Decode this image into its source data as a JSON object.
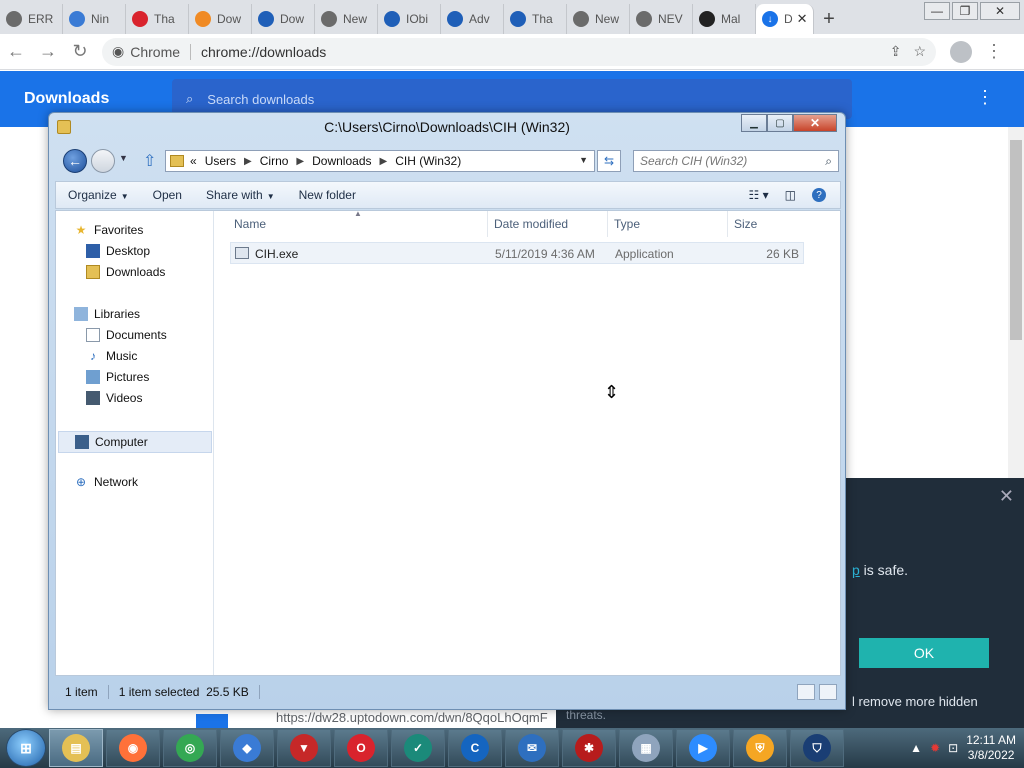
{
  "browser": {
    "tabs": [
      {
        "label": "ERR",
        "icon": "globe-icon",
        "color": "#6b6b6b"
      },
      {
        "label": "Nin",
        "icon": "shield-icon",
        "color": "#3a7bd5"
      },
      {
        "label": "Tha",
        "icon": "opera-icon",
        "color": "#d9232d"
      },
      {
        "label": "Dow",
        "icon": "avast-icon",
        "color": "#f08a24"
      },
      {
        "label": "Dow",
        "icon": "diamond-icon",
        "color": "#1f5fb8"
      },
      {
        "label": "New",
        "icon": "globe-icon",
        "color": "#6b6b6b"
      },
      {
        "label": "IObi",
        "icon": "iobit-icon",
        "color": "#1f5fb8"
      },
      {
        "label": "Adv",
        "icon": "iobit-icon",
        "color": "#1f5fb8"
      },
      {
        "label": "Tha",
        "icon": "iobit-icon",
        "color": "#1f5fb8"
      },
      {
        "label": "New",
        "icon": "globe-icon",
        "color": "#6b6b6b"
      },
      {
        "label": "NEV",
        "icon": "globe-icon",
        "color": "#6b6b6b"
      },
      {
        "label": "Mal",
        "icon": "github-icon",
        "color": "#222222"
      }
    ],
    "active_tab": {
      "label": "D",
      "icon": "download-icon"
    },
    "new_tab": "+",
    "window_controls": {
      "minimize": "—",
      "maximize": "❐",
      "close": "✕"
    },
    "site_chip": "Chrome",
    "url": "chrome://downloads"
  },
  "downloads": {
    "title": "Downloads",
    "search_placeholder": "Search downloads",
    "menu": "⋮",
    "bottom_url": "https://dw28.uptodown.com/dwn/8QqoLhOqmF"
  },
  "dialog": {
    "close": "✕",
    "text_link": "p",
    "text_rest": " is safe.",
    "ok_label": "OK",
    "more_text": "l remove more hidden",
    "threats_text": "threats."
  },
  "explorer": {
    "title": "C:\\Users\\Cirno\\Downloads\\CIH (Win32)",
    "breadcrumbs": [
      "«",
      "Users",
      "Cirno",
      "Downloads",
      "CIH (Win32)"
    ],
    "search_placeholder": "Search CIH (Win32)",
    "commands": {
      "organize": "Organize",
      "open": "Open",
      "share_with": "Share with",
      "new_folder": "New folder"
    },
    "nav": {
      "favorites": "Favorites",
      "desktop": "Desktop",
      "downloads": "Downloads",
      "libraries": "Libraries",
      "documents": "Documents",
      "music": "Music",
      "pictures": "Pictures",
      "videos": "Videos",
      "computer": "Computer",
      "network": "Network"
    },
    "columns": {
      "name": "Name",
      "date_modified": "Date modified",
      "type": "Type",
      "size": "Size"
    },
    "files": [
      {
        "name": "CIH.exe",
        "date_modified": "5/11/2019 4:36 AM",
        "type": "Application",
        "size": "26 KB"
      }
    ],
    "status": {
      "count": "1 item",
      "selected": "1 item selected",
      "selected_size": "25.5 KB"
    }
  },
  "taskbar": {
    "start": "⊞",
    "time": "12:11 AM",
    "date": "3/8/2022",
    "apps": [
      {
        "name": "explorer",
        "icon": "folder-icon",
        "color": "#e4c055",
        "glyph": "▤"
      },
      {
        "name": "firefox",
        "icon": "firefox-icon",
        "color": "#ff7139",
        "glyph": "◉"
      },
      {
        "name": "chrome",
        "icon": "chrome-icon",
        "color": "#34a853",
        "glyph": "◎"
      },
      {
        "name": "app4",
        "icon": "drop-icon",
        "color": "#3a7bd5",
        "glyph": "◆"
      },
      {
        "name": "app5",
        "icon": "shield-icon",
        "color": "#c62828",
        "glyph": "▼"
      },
      {
        "name": "opera",
        "icon": "opera-icon",
        "color": "#d9232d",
        "glyph": "O"
      },
      {
        "name": "app7",
        "icon": "shield-check-icon",
        "color": "#1b8a7a",
        "glyph": "✓"
      },
      {
        "name": "ccleaner",
        "icon": "ccleaner-icon",
        "color": "#1565c0",
        "glyph": "C"
      },
      {
        "name": "app9",
        "icon": "globe-mail-icon",
        "color": "#2e6fbf",
        "glyph": "✉"
      },
      {
        "name": "app10",
        "icon": "malware-icon",
        "color": "#b71c1c",
        "glyph": "✱"
      },
      {
        "name": "app11",
        "icon": "monitor-icon",
        "color": "#8fa4bd",
        "glyph": "▦"
      },
      {
        "name": "zoom",
        "icon": "zoom-icon",
        "color": "#2d8cff",
        "glyph": "▶"
      },
      {
        "name": "app13",
        "icon": "lock-shield-icon",
        "color": "#f5a623",
        "glyph": "⛨"
      },
      {
        "name": "app14",
        "icon": "vpn-shield-icon",
        "color": "#1a3e74",
        "glyph": "⛉"
      }
    ]
  }
}
